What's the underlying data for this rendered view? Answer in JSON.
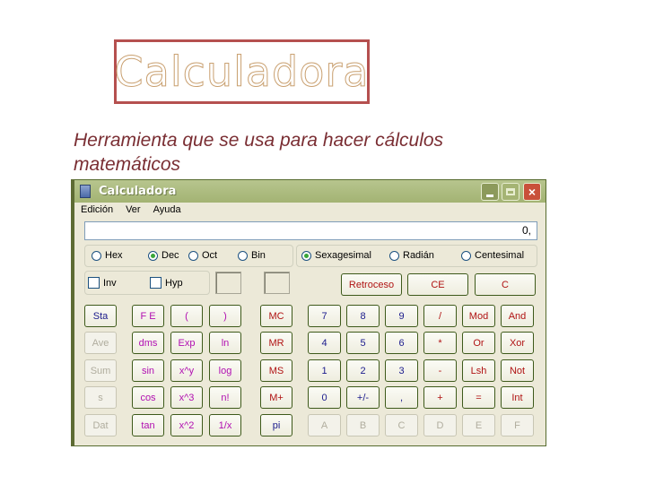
{
  "slide": {
    "title": "Calculadora",
    "subtitle": "Herramienta que se usa para hacer cálculos matemáticos"
  },
  "window": {
    "title": "Calculadora",
    "icon": "calculator-icon",
    "controls": {
      "minimize": "minimize-icon",
      "maximize": "maximize-icon",
      "close": "×"
    },
    "menu": [
      "Edición",
      "Ver",
      "Ayuda"
    ],
    "display_value": "0,"
  },
  "number_base": {
    "options": [
      "Hex",
      "Dec",
      "Oct",
      "Bin"
    ],
    "selected": "Dec"
  },
  "angle_mode": {
    "options": [
      "Sexagesimal",
      "Radián",
      "Centesimal"
    ],
    "selected": "Sexagesimal"
  },
  "checkboxes": [
    {
      "label": "Inv",
      "checked": false
    },
    {
      "label": "Hyp",
      "checked": false
    }
  ],
  "edit_keys": [
    "Retroceso",
    "CE",
    "C"
  ],
  "stat_keys": [
    "Sta",
    "Ave",
    "Sum",
    "s",
    "Dat"
  ],
  "function_keys": [
    [
      "F E",
      "(",
      ")"
    ],
    [
      "dms",
      "Exp",
      "ln"
    ],
    [
      "sin",
      "x^y",
      "log"
    ],
    [
      "cos",
      "x^3",
      "n!"
    ],
    [
      "tan",
      "x^2",
      "1/x"
    ]
  ],
  "memory_keys": [
    "MC",
    "MR",
    "MS",
    "M+",
    "pi"
  ],
  "main_keys": [
    [
      "7",
      "8",
      "9",
      "/",
      "Mod",
      "And"
    ],
    [
      "4",
      "5",
      "6",
      "*",
      "Or",
      "Xor"
    ],
    [
      "1",
      "2",
      "3",
      "-",
      "Lsh",
      "Not"
    ],
    [
      "0",
      "+/-",
      ",",
      "+",
      "=",
      "Int"
    ],
    [
      "A",
      "B",
      "C",
      "D",
      "E",
      "F"
    ]
  ],
  "colors": {
    "title_border": "#b5504f",
    "subtitle_text": "#7a2e33",
    "titlebar": "#a3b373",
    "window_bg": "#ece9d8",
    "key_blue": "#1a1a8c",
    "key_red": "#b01313",
    "key_magenta": "#b10fb1"
  }
}
